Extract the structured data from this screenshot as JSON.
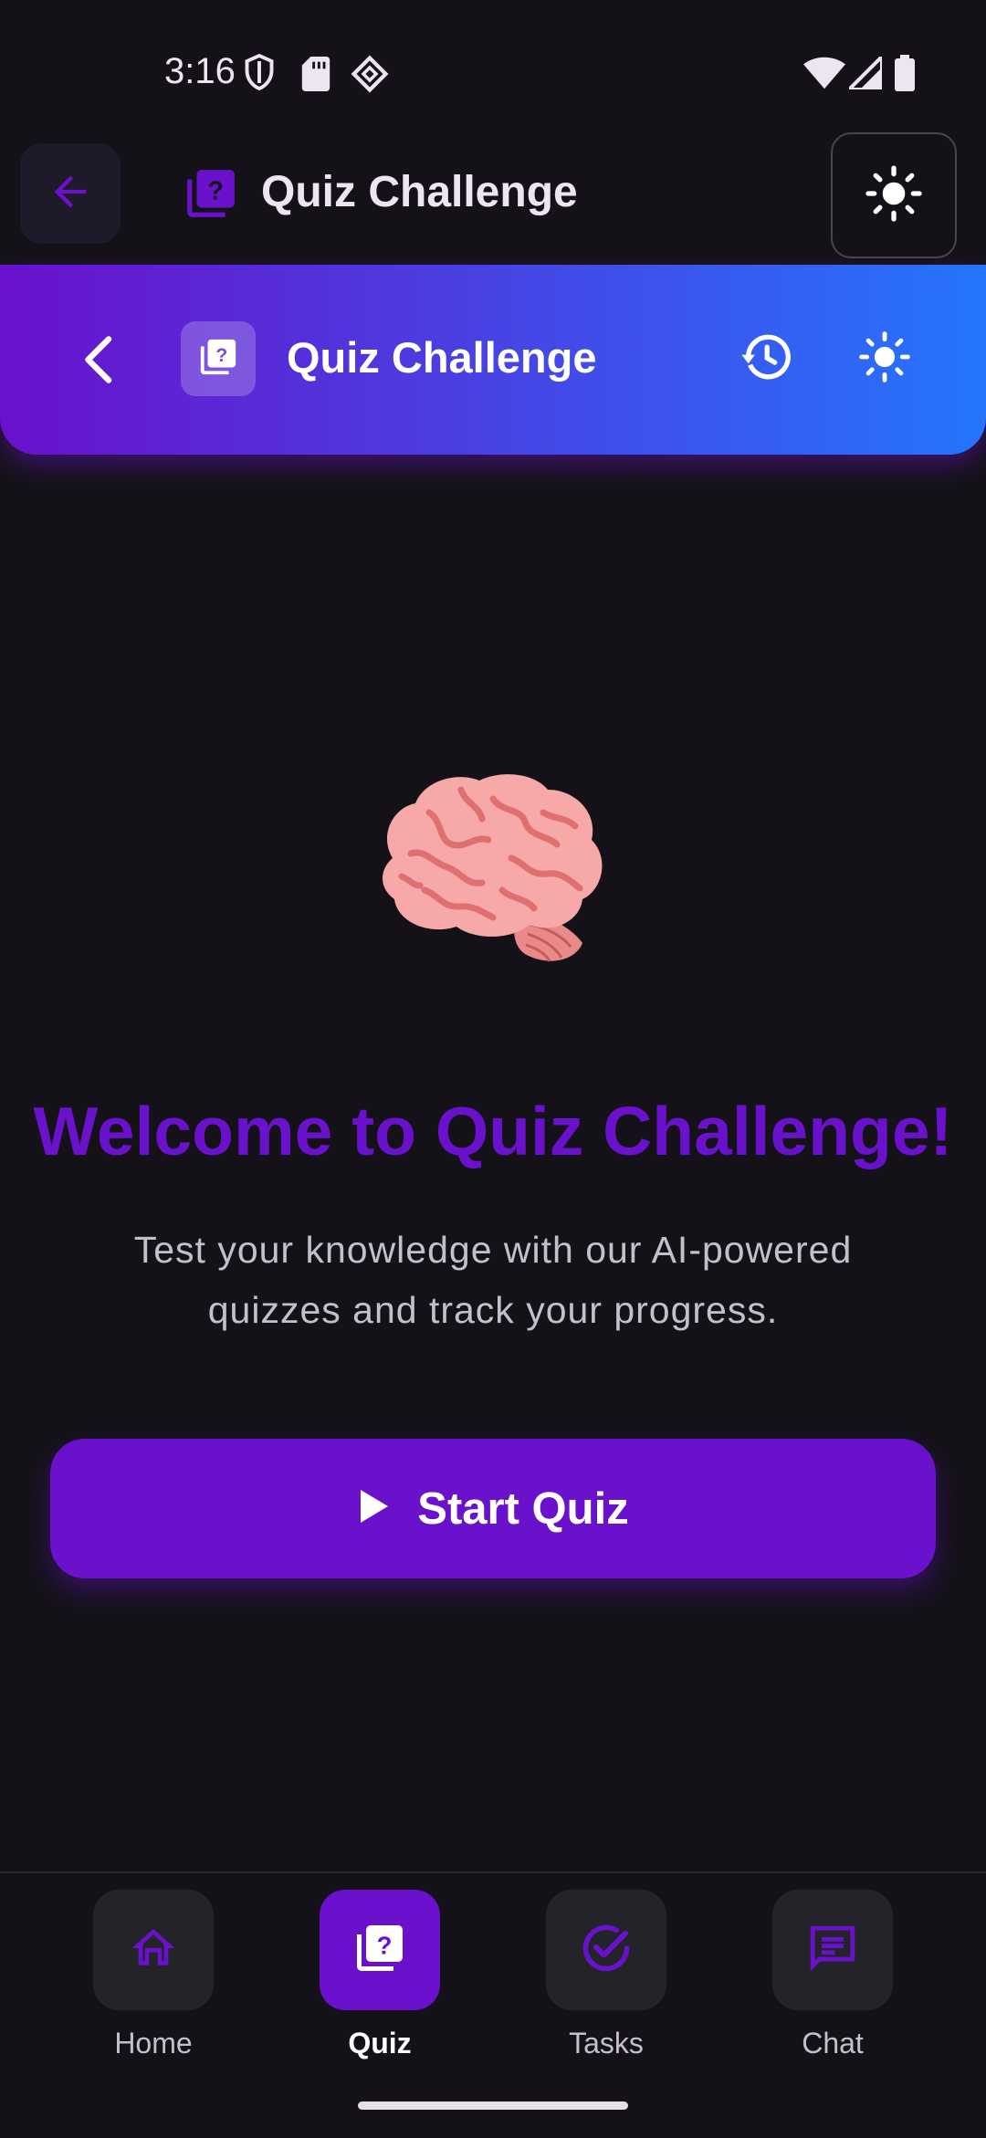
{
  "status_bar": {
    "time": "3:16",
    "icons": [
      "shield-icon",
      "sd-card-icon",
      "app-icon",
      "wifi-icon",
      "signal-icon",
      "battery-icon"
    ]
  },
  "app_bar": {
    "back_icon": "arrow-back-icon",
    "icon": "quiz-icon",
    "title": "Quiz Challenge",
    "theme_icon": "sun-icon"
  },
  "gradient_header": {
    "back_icon": "chevron-left-icon",
    "icon": "quiz-icon",
    "title": "Quiz Challenge",
    "history_icon": "history-icon",
    "theme_icon": "sun-icon"
  },
  "hero": {
    "illustration": "brain-emoji",
    "title": "Welcome to Quiz Challenge!",
    "subtitle_line1": "Test your knowledge with our AI-powered",
    "subtitle_line2": "quizzes and track your progress."
  },
  "start_button": {
    "icon": "play-icon",
    "label": "Start Quiz"
  },
  "bottom_nav": {
    "items": [
      {
        "label": "Home",
        "icon": "home-icon",
        "active": false
      },
      {
        "label": "Quiz",
        "icon": "quiz-icon",
        "active": true
      },
      {
        "label": "Tasks",
        "icon": "check-circle-icon",
        "active": false
      },
      {
        "label": "Chat",
        "icon": "chat-icon",
        "active": false
      }
    ]
  },
  "colors": {
    "background": "#141218",
    "accent": "#6A11CB",
    "gradient_start": "#6A11CB",
    "gradient_end": "#2575FC"
  }
}
